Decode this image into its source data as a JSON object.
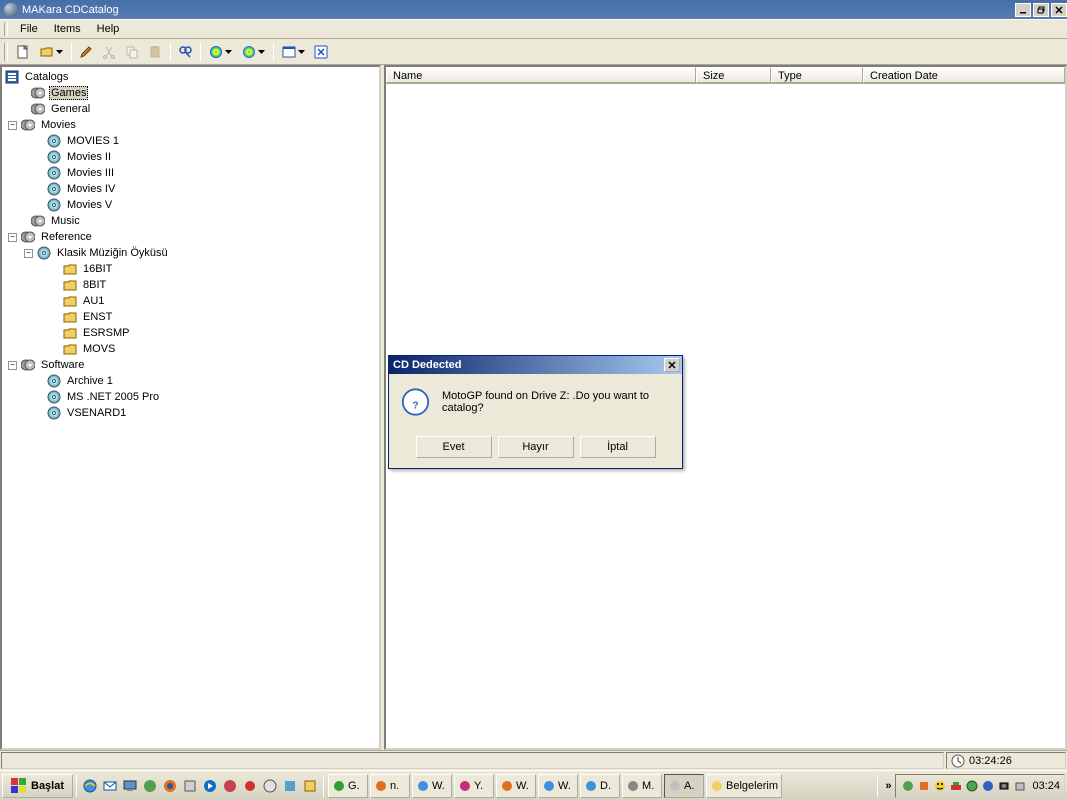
{
  "titlebar": {
    "text": "MAKara CDCatalog"
  },
  "menu": {
    "file": "File",
    "items": "Items",
    "help": "Help"
  },
  "tree": {
    "root": "Catalogs",
    "games": "Games",
    "general": "General",
    "movies": "Movies",
    "movies1": "MOVIES 1",
    "movies2": "Movies II",
    "movies3": "Movies III",
    "movies4": "Movies IV",
    "movies5": "Movies V",
    "music": "Music",
    "reference": "Reference",
    "klasik": "Klasik Müziğin Öyküsü",
    "f16bit": "16BIT",
    "f8bit": "8BIT",
    "au1": "AU1",
    "enst": "ENST",
    "esrsmp": "ESRSMP",
    "movs": "MOVS",
    "software": "Software",
    "archive1": "Archive 1",
    "msnet": "MS .NET 2005 Pro",
    "vsenard": "VSENARD1"
  },
  "columns": {
    "name": "Name",
    "size": "Size",
    "type": "Type",
    "creation": "Creation Date"
  },
  "statusbar": {
    "time": "03:24:26"
  },
  "dialog": {
    "title": "CD Dedected",
    "message": "MotoGP found on Drive Z: .Do you want to catalog?",
    "yes": "Evet",
    "no": "Hayır",
    "cancel": "İptal"
  },
  "taskbar": {
    "start": "Başlat",
    "tasks": [
      "G.",
      "n.",
      "W.",
      "Y.",
      "W.",
      "W.",
      "D.",
      "M.",
      "A.",
      "Belgelerim"
    ],
    "clock": "03:24",
    "chevron": "»"
  }
}
